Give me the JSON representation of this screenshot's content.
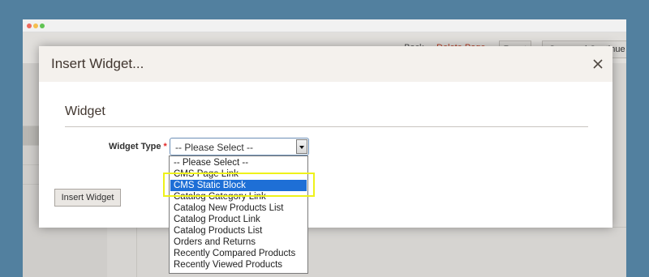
{
  "window": {
    "traffic_lights": [
      "#ee6a5e",
      "#f5be4f",
      "#61c454"
    ]
  },
  "background": {
    "back_label": "Back",
    "delete_label": "Delete Page",
    "reset_label": "Reset",
    "save_continue_label": "Save and Continue Ed"
  },
  "modal": {
    "title": "Insert Widget...",
    "section_title": "Widget",
    "widget_type_label": "Widget Type",
    "required_mark": "*",
    "select_value": "-- Please Select --",
    "insert_button_label": "Insert Widget"
  },
  "dropdown": {
    "selected_index": 2,
    "options": [
      "-- Please Select --",
      "CMS Page Link",
      "CMS Static Block",
      "Catalog Category Link",
      "Catalog New Products List",
      "Catalog Product Link",
      "Catalog Products List",
      "Orders and Returns",
      "Recently Compared Products",
      "Recently Viewed Products"
    ]
  },
  "colors": {
    "highlight": "#eef21a",
    "selected_option": "#1e6fd6",
    "delete_link": "#b8391f"
  }
}
